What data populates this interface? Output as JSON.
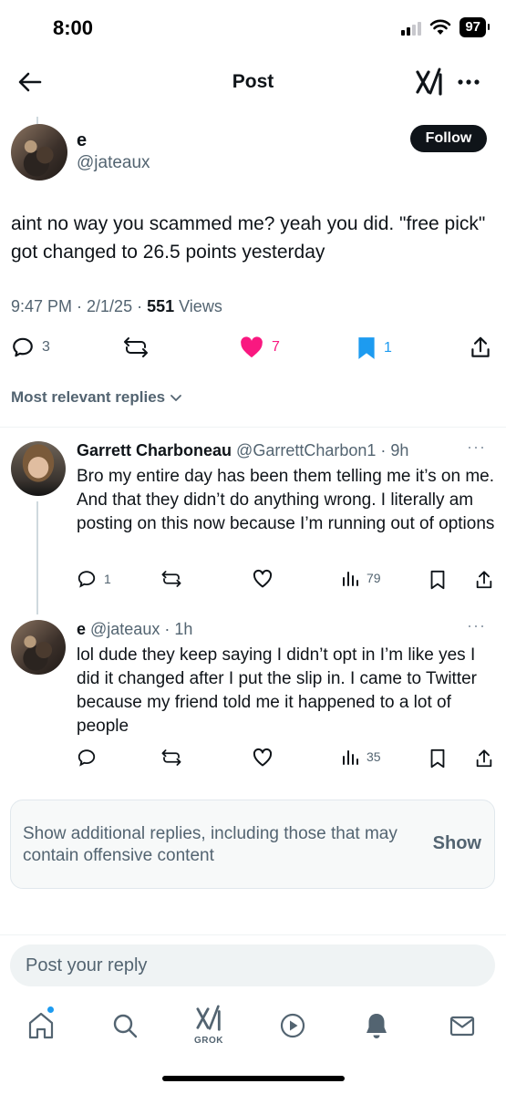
{
  "status": {
    "time": "8:00",
    "battery": "97"
  },
  "header": {
    "title": "Post"
  },
  "post": {
    "name": "e",
    "handle": "@jateaux",
    "follow_label": "Follow",
    "text": "aint no way you scammed me? yeah you did. \"free pick\" got changed to 26.5 points yesterday",
    "meta_prefix": "9:47 PM · 2/1/25 · ",
    "views_count": "551",
    "views_label": " Views",
    "replies": "3",
    "likes": "7",
    "bookmarks": "1",
    "like_color": "#f91880",
    "bookmark_color": "#1d9bf0"
  },
  "replies_header": "Most relevant replies",
  "replies": [
    {
      "name": "Garrett Charboneau",
      "meta": " @GarrettCharbon1 · 9h",
      "text": "Bro my entire day has been them telling me it’s on me. And that they didn’t do anything wrong. I literally am posting on this now because I’m running out of options",
      "reply_count": "1",
      "views": "79"
    },
    {
      "name": "e",
      "meta": " @jateaux · 1h",
      "text": "lol dude they keep saying I didn’t opt in I’m like yes I did it changed after I put the slip in. I came to Twitter because my friend told me it happened to a lot of people",
      "reply_count": "",
      "views": "35"
    }
  ],
  "additional": {
    "text": "Show additional replies, including those that may contain offensive content",
    "button": "Show"
  },
  "reply_input": {
    "placeholder": "Post your reply"
  },
  "tabbar": {
    "grok_label": "GROK"
  }
}
